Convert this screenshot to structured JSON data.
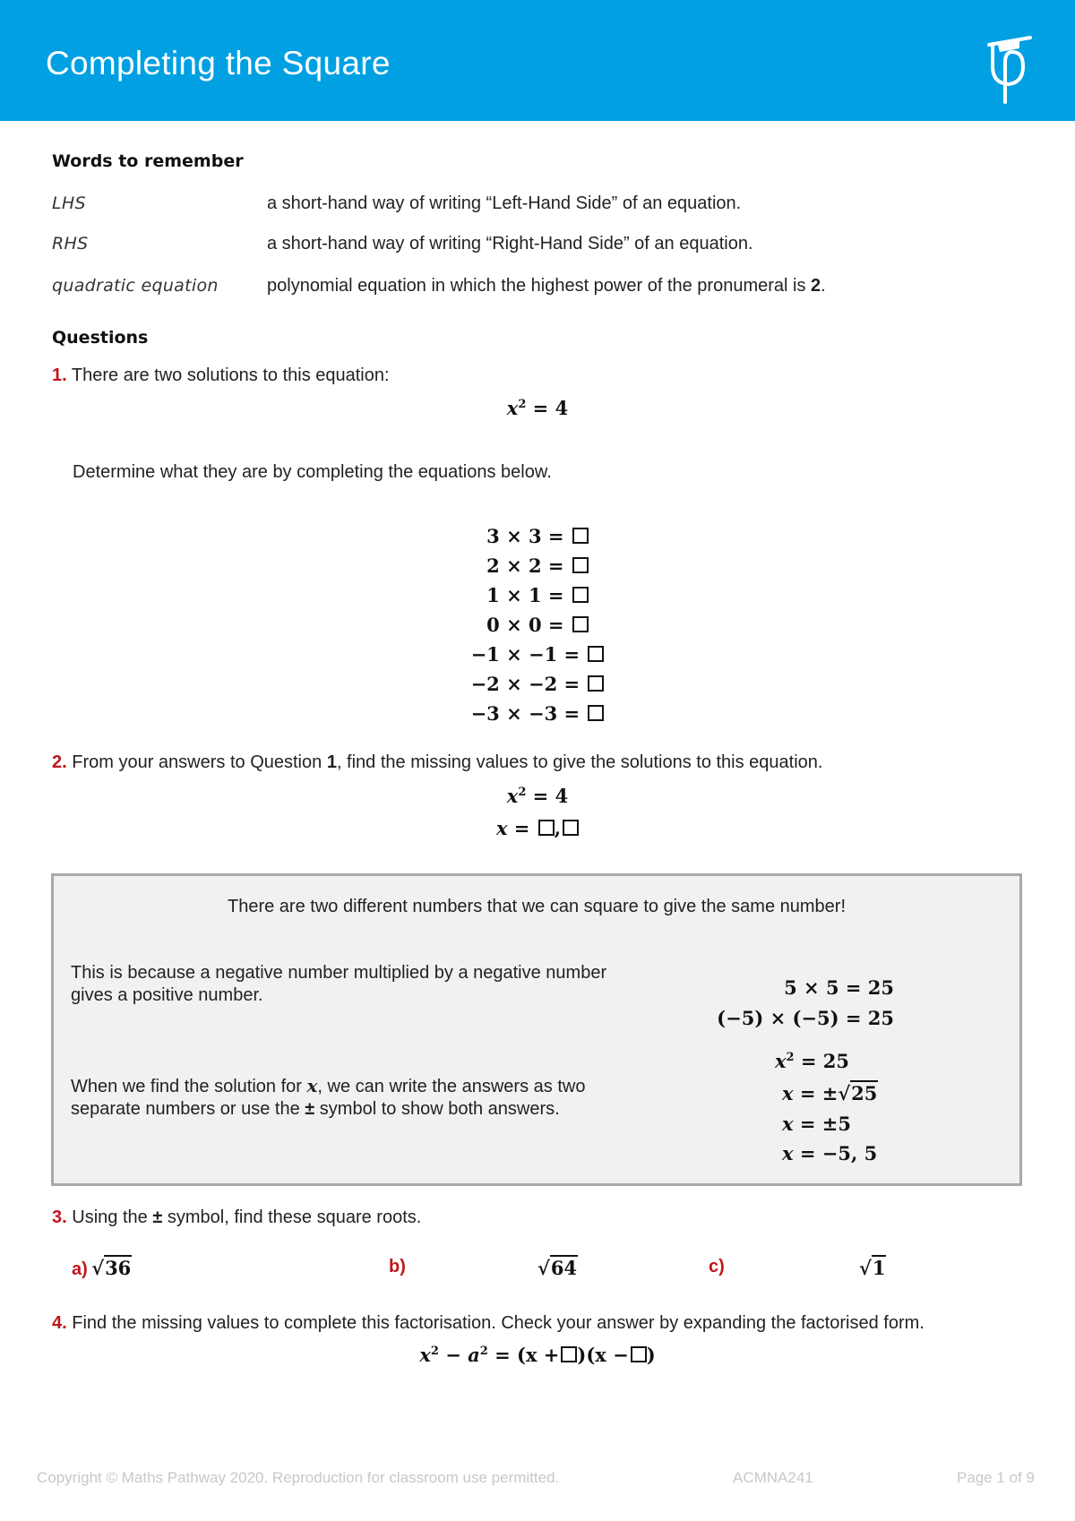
{
  "header": {
    "title": "Completing the Square",
    "logo": "maths-pathway-logo",
    "background_color": "#00a0e2"
  },
  "words": {
    "title": "Words to remember",
    "items": [
      {
        "term": "LHS",
        "definition": "a short-hand way of writing “Left-Hand Side” of an equation."
      },
      {
        "term": "RHS",
        "definition": "a short-hand way of writing “Right-Hand Side” of an equation."
      },
      {
        "term": "quadratic equation",
        "definition": "polynomial equation in which the highest power of the pronumeral is ",
        "definition_bold": "2",
        "definition_end": "."
      }
    ]
  },
  "questions": {
    "title": "Questions",
    "q1": {
      "number": "1.",
      "text": "There are two solutions to this equation:",
      "equation": {
        "var": "x",
        "exp": "2",
        "rhs": "= 4"
      },
      "instruction": "Determine what they are by completing the equations below.",
      "rows": [
        {
          "lhs": "3 × 3 ="
        },
        {
          "lhs": "2 × 2 ="
        },
        {
          "lhs": "1 × 1 ="
        },
        {
          "lhs": "0 × 0 ="
        },
        {
          "lhs": "−1 × −1 ="
        },
        {
          "lhs": "−2 × −2 ="
        },
        {
          "lhs": "−3 × −3 ="
        }
      ]
    },
    "q2": {
      "number": "2.",
      "text_before": "From your answers to Question ",
      "text_bold": "1",
      "text_after": ", find the missing values to give the solutions to this equation.",
      "equation": {
        "var": "x",
        "exp": "2",
        "rhs": "= 4"
      },
      "solution": {
        "var": "x",
        "eq": "=",
        "sep": ","
      }
    },
    "info_box": {
      "heading": "There are two different numbers that we can square to give the same number!",
      "para1": "This is because a negative number multiplied by a negative number gives a positive number.",
      "para2_before": "When we find the solution for ",
      "para2_var": "x",
      "para2_mid": ", we can write the answers as two separate numbers or use the ",
      "para2_symbol": "±",
      "para2_after": " symbol to show both answers.",
      "eq1": "5 × 5 = 25",
      "eq2": "(−5) × (−5) = 25",
      "eq3": {
        "var": "x",
        "exp": "2",
        "rhs": "= 25"
      },
      "eq4": {
        "var": "x",
        "rhs": "= ±",
        "radicand": "25"
      },
      "eq5": {
        "var": "x",
        "rhs": "= ±5"
      },
      "eq6": {
        "var": "x",
        "rhs": "= −5, 5"
      }
    },
    "q3": {
      "number": "3.",
      "text_before": "Using the ",
      "symbol": "±",
      "text_after": " symbol, find these square roots.",
      "parts": [
        {
          "label": "a)",
          "radicand": "36"
        },
        {
          "label": "b)",
          "radicand": "64"
        },
        {
          "label": "c)",
          "radicand": "1"
        }
      ]
    },
    "q4": {
      "number": "4.",
      "text": "Find the missing values to complete this factorisation. Check your answer by expanding the factorised form.",
      "equation": {
        "x": "x",
        "a": "a",
        "exp": "2",
        "minus": "−",
        "eq": "=",
        "open1": "(x +",
        "close_open": ")(x −",
        "close": ")"
      }
    }
  },
  "footer": {
    "copyright": "Copyright © Maths Pathway 2020. Reproduction for classroom use permitted.",
    "code": "ACMNA241",
    "page": "Page 1 of 9"
  },
  "colors": {
    "accent": "#00a0e2",
    "question_number": "#c0161c",
    "info_box_bg": "#f1f1f1",
    "info_box_border": "#a9a9a9",
    "footer_text": "#c8c8c8"
  }
}
